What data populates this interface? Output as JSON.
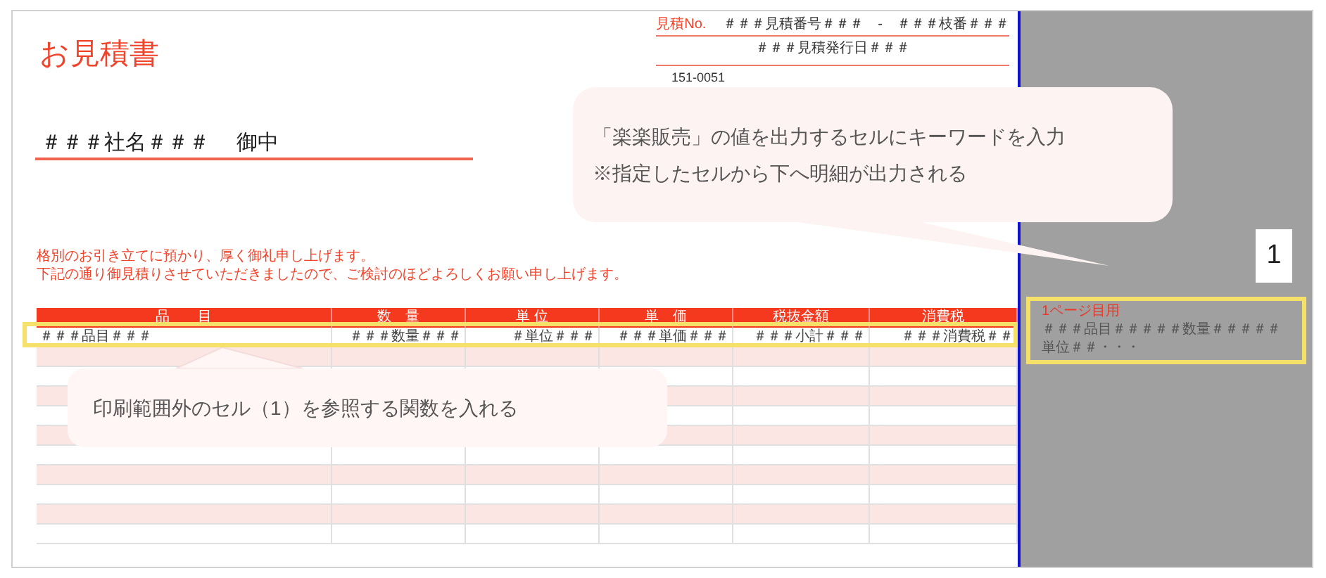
{
  "document": {
    "title": "お見積書",
    "quote_no_label": "見積No.",
    "quote_no": "＃＃＃見積番号＃＃＃　-　＃＃＃枝番＃＃＃",
    "issue_date": "＃＃＃見積発行日＃＃＃",
    "postal_code": "151-0051",
    "recipient": "＃＃＃社名＃＃＃　 御中",
    "greeting": [
      "格別のお引き立てに預かり、厚く御礼申し上げます。",
      "下記の通り御見積りさせていただきましたので、ご検討のほどよろしくお願い申し上げます。"
    ]
  },
  "table": {
    "columns": [
      "品　　目",
      "数　量",
      "単 位",
      "単　価",
      "税抜金額",
      "消費税"
    ],
    "rows": [
      {
        "cells": [
          "＃＃＃品目＃＃＃",
          "＃＃＃数量＃＃＃",
          "＃単位＃＃＃",
          "＃＃＃単価＃＃＃",
          "＃＃＃小計＃＃＃",
          "＃＃＃消費税＃＃"
        ]
      }
    ]
  },
  "side_panel": {
    "page_number": "1",
    "label": "1ページ目用",
    "content": "＃＃＃品目＃＃＃＃＃数量＃＃＃＃＃単位＃＃・・・"
  },
  "callouts": [
    {
      "lines": [
        "「楽楽販売」の値を出力するセルにキーワードを入力",
        "※指定したセルから下へ明細が出力される"
      ]
    },
    {
      "lines": [
        "印刷範囲外のセル（1）を参照する関数を入れる"
      ]
    }
  ]
}
